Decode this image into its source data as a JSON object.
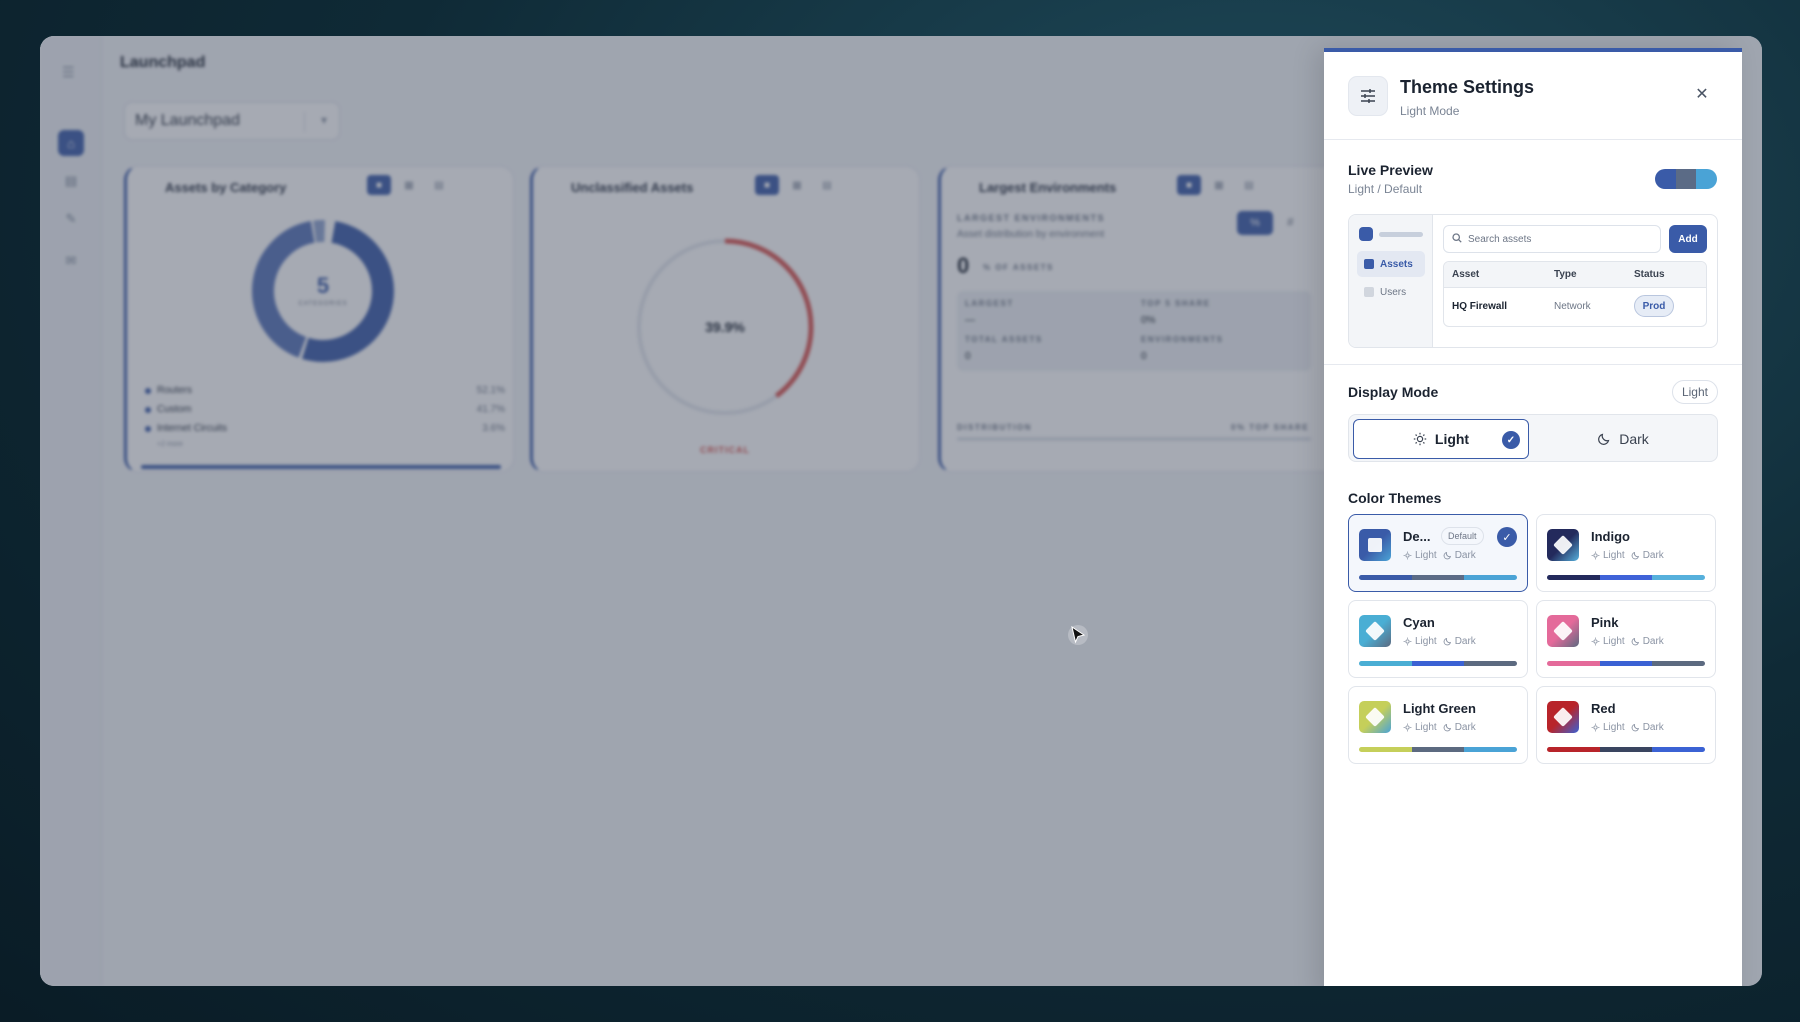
{
  "app": {
    "title": "Launchpad",
    "launchpad_select": "My Launchpad"
  },
  "cards": [
    {
      "title": "Assets by Category",
      "center_value": "5",
      "center_label": "CATEGORIES",
      "legend": [
        {
          "label": "Routers",
          "pct": "52.1%"
        },
        {
          "label": "Custom",
          "pct": "41.7%"
        },
        {
          "label": "Internet Circuits",
          "pct": "3.6%"
        }
      ],
      "more": "+2 more"
    },
    {
      "title": "Unclassified Assets",
      "center_value": "39.9%",
      "status": "CRITICAL"
    },
    {
      "title": "Largest Environments",
      "heading": "LARGEST ENVIRONMENTS",
      "subheading": "Asset distribution by environment",
      "big_value": "0",
      "big_label": "% OF ASSETS",
      "pct_toggle": "%",
      "hash_toggle": "#",
      "stats": [
        {
          "label": "LARGEST",
          "value": "—"
        },
        {
          "label": "TOP 5 SHARE",
          "value": "0%"
        },
        {
          "label": "TOTAL ASSETS",
          "value": "0"
        },
        {
          "label": "ENVIRONMENTS",
          "value": "0"
        }
      ],
      "distribution_label": "DISTRIBUTION",
      "distribution_right": "0% TOP SHARE"
    }
  ],
  "drawer": {
    "title": "Theme Settings",
    "subtitle": "Light Mode",
    "live_preview": {
      "title": "Live Preview",
      "subtitle": "Light / Default",
      "nav": [
        "Assets",
        "Users"
      ],
      "search_placeholder": "Search assets",
      "add_label": "Add",
      "columns": [
        "Asset",
        "Type",
        "Status"
      ],
      "row": {
        "asset": "HQ Firewall",
        "type": "Network",
        "status": "Prod"
      }
    },
    "display_mode": {
      "title": "Display Mode",
      "chip": "Light",
      "options": [
        "Light",
        "Dark"
      ],
      "selected": "Light"
    },
    "color_themes": {
      "title": "Color Themes",
      "light_label": "Light",
      "dark_label": "Dark",
      "default_badge": "Default",
      "themes": [
        {
          "name": "De...",
          "selected": true,
          "colors": [
            "#3a5ba8",
            "#5b6b86",
            "#4aa3d6"
          ]
        },
        {
          "name": "Indigo",
          "selected": false,
          "colors": [
            "#232a5c",
            "#3f63d8",
            "#56b0dc"
          ]
        },
        {
          "name": "Cyan",
          "selected": false,
          "colors": [
            "#4aaed4",
            "#3b62d4",
            "#5c6a80"
          ]
        },
        {
          "name": "Pink",
          "selected": false,
          "colors": [
            "#e46a9a",
            "#3b62d4",
            "#5c6a80"
          ]
        },
        {
          "name": "Light Green",
          "selected": false,
          "colors": [
            "#c5cf5a",
            "#5c6a80",
            "#4aa3d6"
          ]
        },
        {
          "name": "Red",
          "selected": false,
          "colors": [
            "#b8242a",
            "#3a4560",
            "#3b62d4"
          ]
        }
      ]
    }
  },
  "colors": {
    "accent": "#3a5ba8",
    "critical": "#d9534f"
  }
}
